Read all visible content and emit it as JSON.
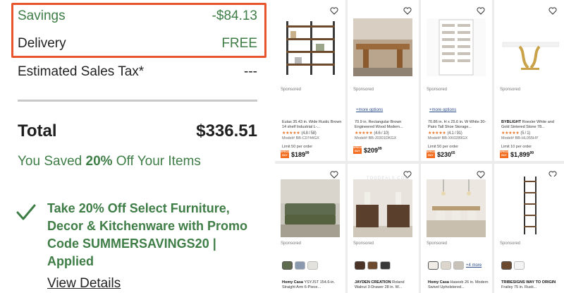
{
  "summary": {
    "savings_label": "Savings",
    "savings_value": "-$84.13",
    "delivery_label": "Delivery",
    "delivery_value": "FREE",
    "tax_label": "Estimated Sales Tax*",
    "tax_value": "---",
    "total_label": "Total",
    "total_value": "$336.51",
    "saved_prefix": "You Saved ",
    "saved_percent": "20%",
    "saved_suffix": " Off Your Items",
    "promo_text": "Take 20% Off Select Furniture, Decor & Kitchenware with Promo Code SUMMERSAVINGS20 | Applied",
    "view_details": "View Details"
  },
  "products_row1": [
    {
      "sponsored": "Sponsored",
      "more_options": "",
      "brand": "",
      "title": "Eulas 35.43 in. Wide Rustic Brown 14 shelf Industrial L-...",
      "stars": "★★★★★",
      "rating": "(4.8 / 58)",
      "model": "Model# BB-C0744GX",
      "limit": "Limit 50 per order",
      "price_dollars": "$189",
      "price_cents": "99"
    },
    {
      "sponsored": "Sponsored",
      "more_options": "+more options",
      "brand": "",
      "title": "70.9 in. Rectangular Brown Engineered Wood Modern...",
      "stars": "★★★★★",
      "rating": "(4.6 / 10)",
      "model": "Model# BB-J0301DKGX",
      "limit": "",
      "price_dollars": "$209",
      "price_cents": "99"
    },
    {
      "sponsored": "Sponsored",
      "more_options": "+more options",
      "brand": "",
      "title": "70.86 in. H x 25.6 in. W White 30-Pairs Tall Shoe Storage...",
      "stars": "★★★★★",
      "rating": "(4.1 / 91)",
      "model": "Model# BB-XK0289GX",
      "limit": "Limit 50 per order",
      "price_dollars": "$230",
      "price_cents": "65"
    },
    {
      "sponsored": "Sponsored",
      "more_options": "",
      "brand": "BYBLIGHT",
      "title": " Roesler White and Gold Sintered Stone 78...",
      "stars": "★★★★★",
      "rating": "(5 / 1)",
      "model": "Model# BB-HL055HY",
      "limit": "Limit 10 per order",
      "price_dollars": "$1,899",
      "price_cents": "99"
    }
  ],
  "products_row2": [
    {
      "sponsored": "Sponsored",
      "brand": "Homy Casa",
      "title": " YSYJST 154.6-in. Straight Arm 6-Piece...",
      "more": ""
    },
    {
      "sponsored": "Sponsored",
      "brand": "JAYDEN CREATION",
      "title": " Roland Walnut 3-Drawer 28 in. W...",
      "more": ""
    },
    {
      "sponsored": "Sponsored",
      "brand": "Homy Casa",
      "title": " Haseeb 26 in. Modern Swivel Upholstered...",
      "more": "+4 more"
    },
    {
      "sponsored": "Sponsored",
      "brand": "TRIBESIGNS WAY TO ORIGIN",
      "title": " Frailey 75 in. Rusti...",
      "more": ""
    }
  ],
  "badge_text": "SPECIAL BUY",
  "watermark": "TOGDEALS.COM",
  "colors": {
    "accent_green": "#3e7d46",
    "highlight_border": "#e8552d",
    "star_orange": "#e8752b",
    "badge_orange": "#f36e20"
  }
}
